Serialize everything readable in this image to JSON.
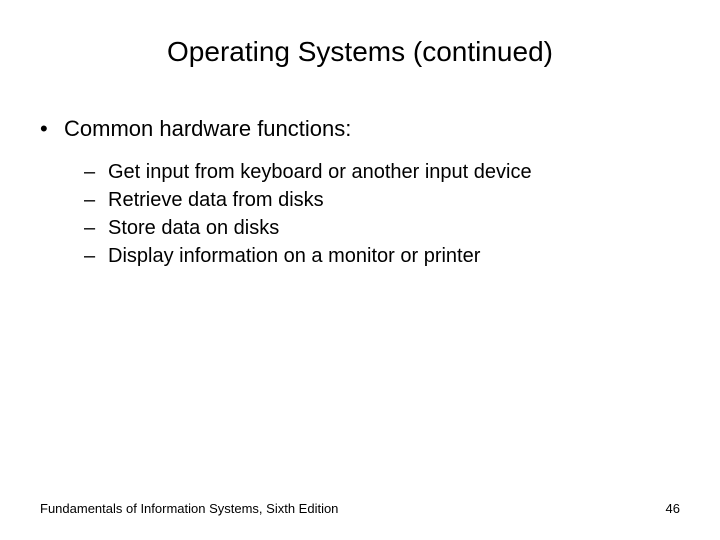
{
  "slide": {
    "title": "Operating Systems (continued)",
    "bullet": "Common hardware functions:",
    "subitems": [
      "Get input from keyboard or another input device",
      "Retrieve data from disks",
      "Store data on disks",
      "Display information on a monitor or printer"
    ]
  },
  "footer": {
    "text": "Fundamentals of Information Systems, Sixth Edition",
    "page": "46"
  }
}
